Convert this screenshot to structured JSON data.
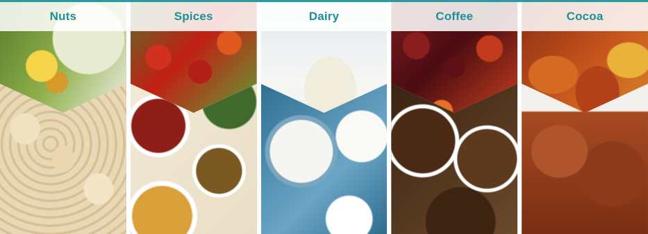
{
  "colors": {
    "accent": "#2a9ba1",
    "label_text": "#1f8f96",
    "label_bar": "#ffffff"
  },
  "categories": [
    {
      "label": "Nuts"
    },
    {
      "label": "Spices"
    },
    {
      "label": "Dairy"
    },
    {
      "label": "Coffee"
    },
    {
      "label": "Cocoa"
    }
  ]
}
